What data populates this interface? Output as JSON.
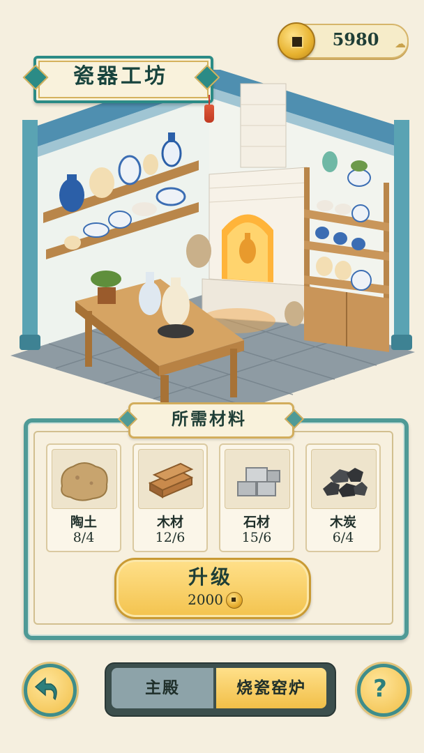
{
  "header": {
    "title": "瓷器工坊",
    "coins": "5980"
  },
  "materials_panel": {
    "title": "所需材料",
    "items": [
      {
        "name": "陶土",
        "count": "8/4",
        "icon": "clay-icon"
      },
      {
        "name": "木材",
        "count": "12/6",
        "icon": "wood-icon"
      },
      {
        "name": "石材",
        "count": "15/6",
        "icon": "stone-icon"
      },
      {
        "name": "木炭",
        "count": "6/4",
        "icon": "charcoal-icon"
      }
    ],
    "upgrade": {
      "label": "升级",
      "cost": "2000"
    }
  },
  "bottom_nav": {
    "tabs": [
      {
        "label": "主殿",
        "active": false
      },
      {
        "label": "烧瓷窑炉",
        "active": true
      }
    ],
    "back_icon": "back-arrow-icon",
    "help_icon": "question-icon"
  },
  "colors": {
    "teal_frame": "#4f9a96",
    "gold": "#f3c34e",
    "parchment": "#f7f0df",
    "blue_porcelain": "#2b5fa8"
  }
}
